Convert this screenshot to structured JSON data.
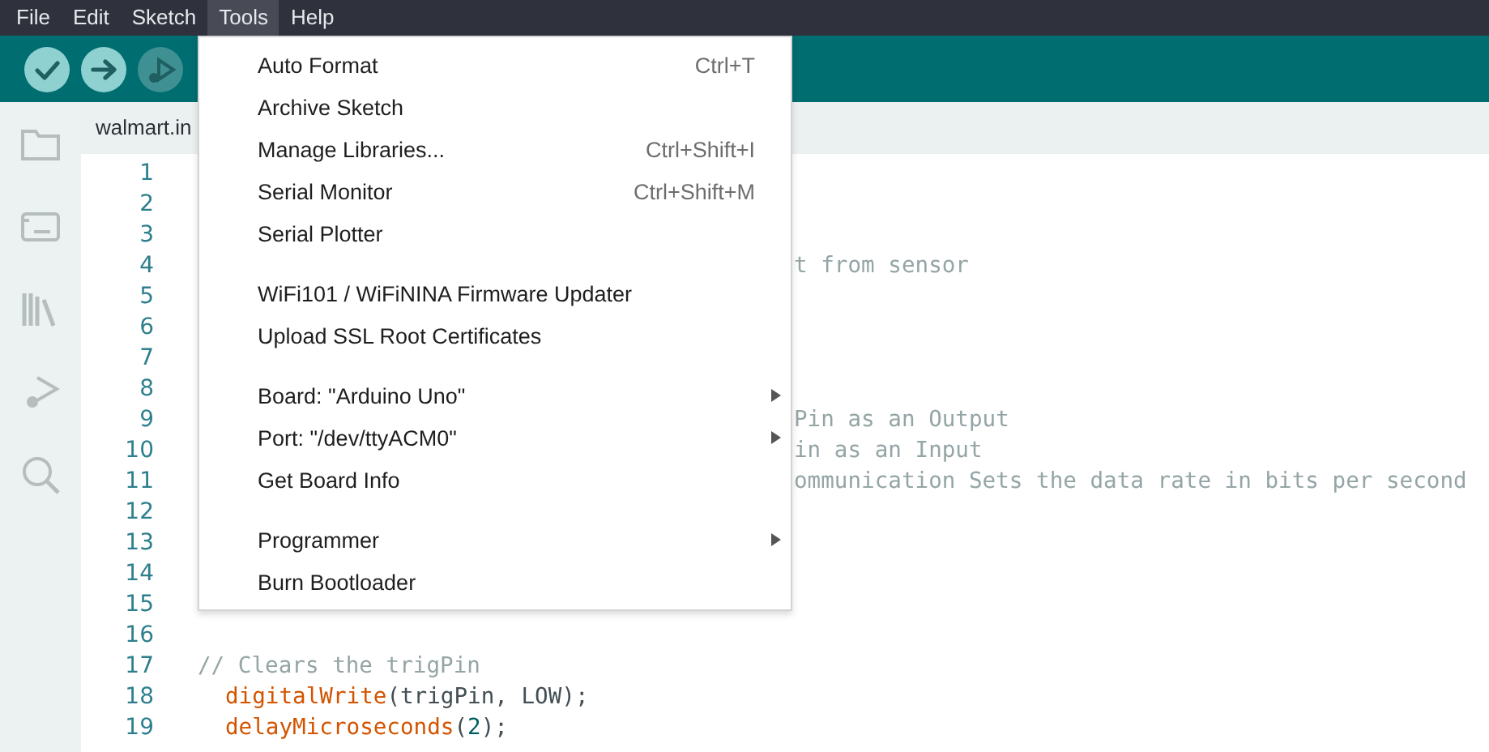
{
  "menubar": [
    {
      "label": "File",
      "selected": false
    },
    {
      "label": "Edit",
      "selected": false
    },
    {
      "label": "Sketch",
      "selected": false
    },
    {
      "label": "Tools",
      "selected": true
    },
    {
      "label": "Help",
      "selected": false
    }
  ],
  "toolbar": [
    {
      "kind": "verify",
      "disabled": false
    },
    {
      "kind": "upload",
      "disabled": false
    },
    {
      "kind": "debug",
      "disabled": true
    }
  ],
  "sidebar": [
    {
      "kind": "folder"
    },
    {
      "kind": "board"
    },
    {
      "kind": "library"
    },
    {
      "kind": "debug"
    },
    {
      "kind": "search"
    }
  ],
  "editor_tab": {
    "label": "walmart.in"
  },
  "code_lines": [
    {
      "number": "1"
    },
    {
      "number": "2"
    },
    {
      "number": "3"
    },
    {
      "number": "4",
      "kind": "clipped",
      "tokens": [
        {
          "text": "t from sensor",
          "kind": "comment"
        }
      ]
    },
    {
      "number": "5"
    },
    {
      "number": "6"
    },
    {
      "number": "7"
    },
    {
      "number": "8"
    },
    {
      "number": "9",
      "kind": "clipped",
      "tokens": [
        {
          "text": "Pin as an Output",
          "kind": "comment"
        }
      ]
    },
    {
      "number": "10",
      "kind": "clipped",
      "tokens": [
        {
          "text": "in as an Input",
          "kind": "comment"
        }
      ]
    },
    {
      "number": "11",
      "kind": "clipped",
      "tokens": [
        {
          "text": "ommunication Sets the data rate in bits per second",
          "kind": "comment"
        }
      ]
    },
    {
      "number": "12"
    },
    {
      "number": "13"
    },
    {
      "number": "14"
    },
    {
      "number": "15"
    },
    {
      "number": "16"
    },
    {
      "number": "17",
      "kind": "full",
      "tokens": [
        {
          "text": "// Clears the trigPin",
          "kind": "comment"
        }
      ]
    },
    {
      "number": "18",
      "kind": "indented",
      "tokens": [
        {
          "text": "digitalWrite",
          "kind": "function"
        },
        {
          "text": "(trigPin, LOW);",
          "kind": "plain"
        }
      ]
    },
    {
      "number": "19",
      "kind": "indented",
      "tokens": [
        {
          "text": "delayMicroseconds",
          "kind": "function"
        },
        {
          "text": "(",
          "kind": "plain"
        },
        {
          "text": "2",
          "kind": "number"
        },
        {
          "text": ");",
          "kind": "plain"
        }
      ]
    }
  ],
  "tools_menu": [
    {
      "kind": "item",
      "label": "Auto Format",
      "shortcut": "Ctrl+T",
      "submenu": false
    },
    {
      "kind": "item",
      "label": "Archive Sketch",
      "submenu": false
    },
    {
      "kind": "item",
      "label": "Manage Libraries...",
      "shortcut": "Ctrl+Shift+I",
      "submenu": false
    },
    {
      "kind": "item",
      "label": "Serial Monitor",
      "shortcut": "Ctrl+Shift+M",
      "submenu": false
    },
    {
      "kind": "item",
      "label": "Serial Plotter",
      "submenu": false
    },
    {
      "kind": "separator"
    },
    {
      "kind": "item",
      "label": "WiFi101 / WiFiNINA Firmware Updater",
      "submenu": false
    },
    {
      "kind": "item",
      "label": "Upload SSL Root Certificates",
      "submenu": false
    },
    {
      "kind": "separator"
    },
    {
      "kind": "item",
      "label": "Board: \"Arduino Uno\"",
      "submenu": true
    },
    {
      "kind": "item",
      "label": "Port: \"/dev/ttyACM0\"",
      "submenu": true
    },
    {
      "kind": "item",
      "label": "Get Board Info",
      "submenu": false
    },
    {
      "kind": "separator"
    },
    {
      "kind": "item",
      "label": "Programmer",
      "submenu": true
    },
    {
      "kind": "item",
      "label": "Burn Bootloader",
      "submenu": false
    }
  ]
}
